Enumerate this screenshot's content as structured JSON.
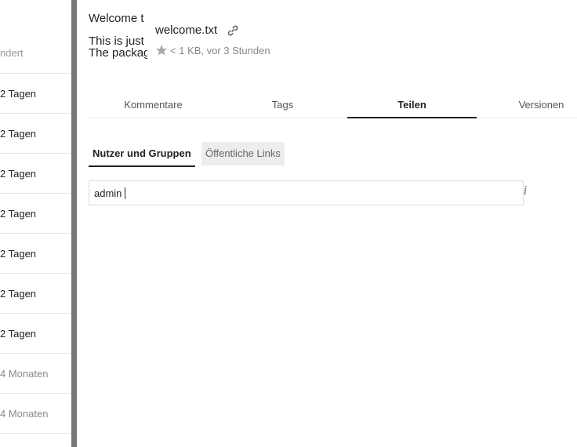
{
  "file_list": {
    "header_label": "ndert",
    "rows": [
      {
        "modified": "2 Tagen",
        "faded": false
      },
      {
        "modified": "2 Tagen",
        "faded": false
      },
      {
        "modified": "2 Tagen",
        "faded": false
      },
      {
        "modified": "2 Tagen",
        "faded": false
      },
      {
        "modified": "2 Tagen",
        "faded": false
      },
      {
        "modified": "2 Tagen",
        "faded": false
      },
      {
        "modified": "2 Tagen",
        "faded": false
      },
      {
        "modified": "4 Monaten",
        "faded": true
      },
      {
        "modified": "4 Monaten",
        "faded": true
      }
    ]
  },
  "sidebar": {
    "preview": {
      "title": "Welcome t",
      "line1": "This is just",
      "line2": "The packag"
    },
    "filename": "welcome.txt",
    "meta": "< 1 KB, vor 3 Stunden",
    "icons": {
      "link": "link-icon",
      "star": "star-icon",
      "info": "info-icon"
    },
    "tabs": [
      {
        "label": "Kommentare",
        "active": false
      },
      {
        "label": "Tags",
        "active": false
      },
      {
        "label": "Teilen",
        "active": true
      },
      {
        "label": "Versionen",
        "active": false
      }
    ],
    "subtabs": {
      "users_groups": "Nutzer und Gruppen",
      "public_links": "Öffentliche Links"
    },
    "share_input": {
      "value": "admin"
    },
    "info_glyph": "i"
  },
  "colors": {
    "divider": "#777777",
    "active_tab": "#222222",
    "inactive_subtab_bg": "#ededed"
  }
}
